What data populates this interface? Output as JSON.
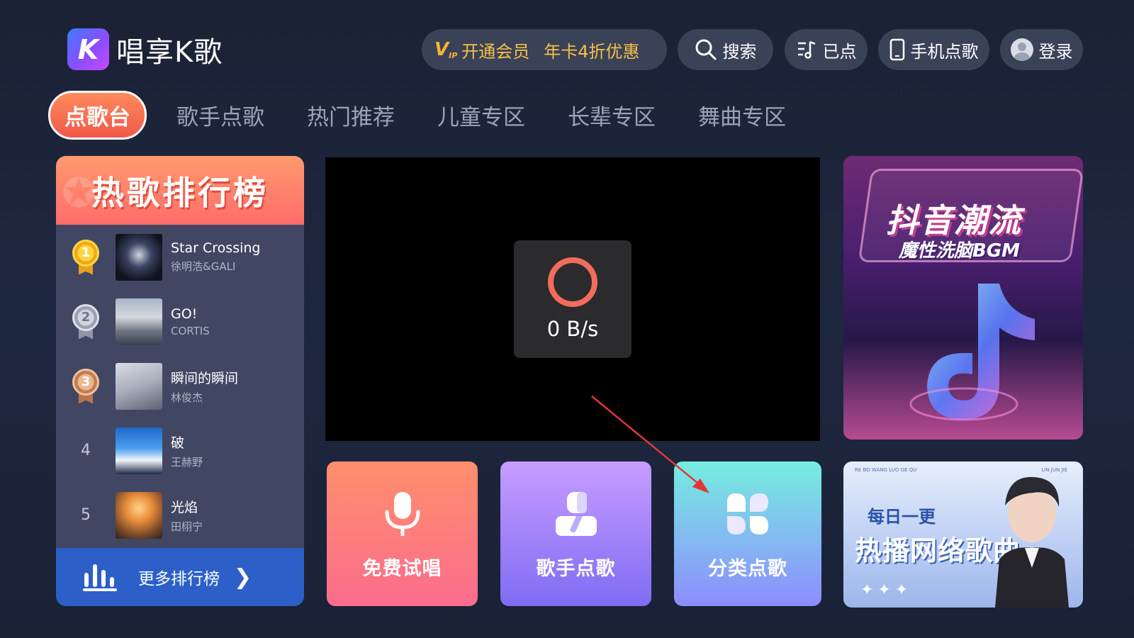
{
  "app": {
    "logo_letter": "K",
    "name": "唱享K歌"
  },
  "header": {
    "vip": {
      "badge": "V",
      "badge_small": "IP",
      "label": "开通会员",
      "promo": "年卡4折优惠",
      "color": "#f5c046"
    },
    "search_label": "搜索",
    "queued_label": "已点",
    "phone_label": "手机点歌",
    "login_label": "登录"
  },
  "nav": {
    "tabs": [
      {
        "label": "点歌台",
        "active": true
      },
      {
        "label": "歌手点歌",
        "active": false
      },
      {
        "label": "热门推荐",
        "active": false
      },
      {
        "label": "儿童专区",
        "active": false
      },
      {
        "label": "长辈专区",
        "active": false
      },
      {
        "label": "舞曲专区",
        "active": false
      }
    ]
  },
  "hot_chart": {
    "title": "热歌排行榜",
    "songs": [
      {
        "rank": "1",
        "medal": "gold",
        "title": "Star Crossing",
        "artist": "徐明浩&GALI"
      },
      {
        "rank": "2",
        "medal": "silver",
        "title": "GO!",
        "artist": "CORTIS"
      },
      {
        "rank": "3",
        "medal": "bronze",
        "title": "瞬间的瞬间",
        "artist": "林俊杰"
      },
      {
        "rank": "4",
        "medal": "none",
        "title": "破",
        "artist": "王赫野"
      },
      {
        "rank": "5",
        "medal": "none",
        "title": "光焰",
        "artist": "田栩宁"
      }
    ],
    "more_label": "更多排行榜"
  },
  "player": {
    "loading_speed": "0 B/s"
  },
  "tiles": {
    "free_sing": "免费试唱",
    "singer": "歌手点歌",
    "category": "分类点歌"
  },
  "banners": {
    "douyin": {
      "title": "抖音潮流",
      "subtitle": "魔性洗脑BGM"
    },
    "daily": {
      "top_left": "RE BO WANG LUO GE QU",
      "top_right": "LIN JUN JIE",
      "daily_label": "每日一更",
      "title": "热播网络歌曲"
    }
  },
  "colors": {
    "accent_tab": "#f0584a",
    "more_bar": "#2c5fc8",
    "spinner": "#f26b5b"
  }
}
